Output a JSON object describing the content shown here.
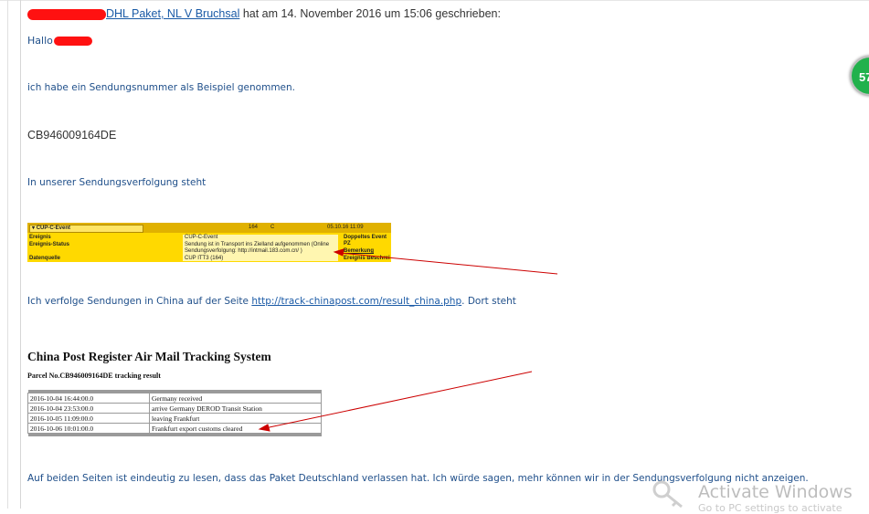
{
  "header": {
    "sender_link": "DHL Paket, NL V Bruchsal",
    "meta": " hat am 14. November 2016 um 15:06 geschrieben:"
  },
  "greeting": "Hallo",
  "para1": "ich habe ein Sendungsnummer als Beispiel genommen.",
  "tracking_number": "CB946009164DE",
  "para2": "In unserer Sendungsverfolgung steht",
  "dhl_screenshot": {
    "dropdown": "CUP-C-Event",
    "num": "164",
    "code": "C",
    "date": "05.10.16 11:09",
    "row_labels": [
      "Ereignis",
      "Ereignis-Status",
      "Datenquelle"
    ],
    "event": "CUP-C-Event",
    "status_line1": "Sendung ist in Transport ins Zielland aufgenommen (Online",
    "status_line2": "Sendungsverfolgung: http://intmail.183.com.cn/ )",
    "source": "CUP ITT3 (164)",
    "right_labels": [
      "Doppeltes Event",
      "PZ",
      "Bemerkung",
      "Ereignis Beschrei"
    ]
  },
  "para3_prefix": "Ich verfolge Sendungen in China auf der Seite ",
  "para3_link": "http://track-chinapost.com/result_china.php",
  "para3_suffix": ". Dort steht",
  "china_post": {
    "title": "China Post Register Air Mail Tracking System",
    "subtitle": "Parcel No.CB946009164DE tracking result",
    "rows": [
      {
        "time": "2016-10-04 16:44:00.0",
        "event": "Germany received"
      },
      {
        "time": "2016-10-04 23:53:00.0",
        "event": "arrive Germany DEROD Transit Station"
      },
      {
        "time": "2016-10-05 11:09:00.0",
        "event": "leaving Frankfurt"
      },
      {
        "time": "2016-10-06 10:01:00.0",
        "event": "Frankfurt export customs cleared"
      }
    ]
  },
  "para4": "Auf beiden Seiten ist eindeutig zu lesen, dass das Paket Deutschland verlassen hat. Ich würde sagen, mehr können wir in der Sendungsverfolgung nicht anzeigen.",
  "badge": "57",
  "watermark": {
    "line1": "Activate Windows",
    "line2": "Go to PC settings to activate"
  },
  "colors": {
    "link": "#1a5aa6",
    "body_text": "#1f4f8a",
    "redaction": "#ff1111",
    "arrow": "#cc0000",
    "dhl_yellow": "#ffd900"
  }
}
